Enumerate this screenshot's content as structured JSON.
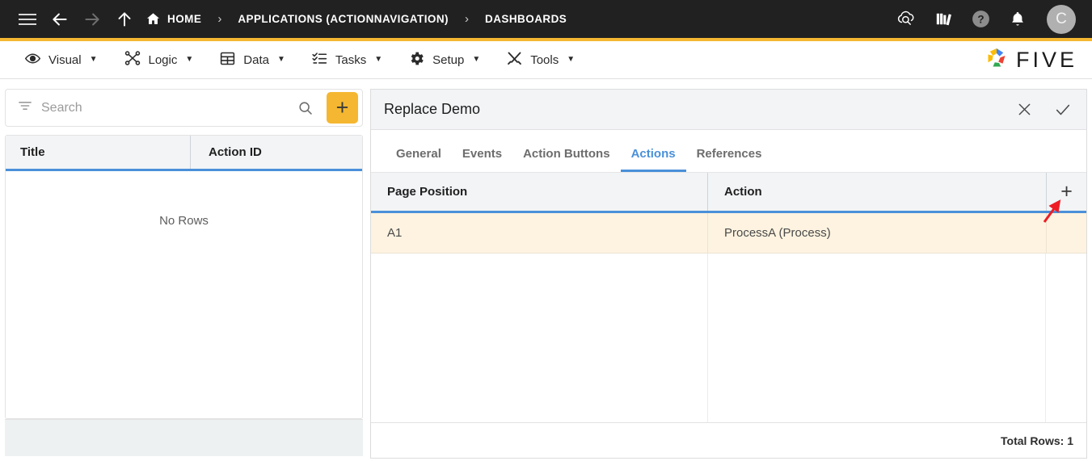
{
  "topbar": {
    "icons": {
      "menu": "hamburger-icon",
      "back": "arrow-left-icon",
      "forward": "arrow-right-icon",
      "up": "arrow-up-icon",
      "home": "home-icon",
      "cloud": "cloud-search-icon",
      "library": "books-icon",
      "help": "question-mark-icon",
      "notifications": "bell-icon"
    },
    "breadcrumb": [
      {
        "label": "HOME",
        "icon": "home-icon"
      },
      {
        "label": "APPLICATIONS (ACTIONNAVIGATION)"
      },
      {
        "label": "DASHBOARDS"
      }
    ],
    "separator": "›",
    "avatar_initial": "C"
  },
  "menubar": {
    "items": [
      {
        "label": "Visual",
        "icon": "eye-icon",
        "caret": "▼"
      },
      {
        "label": "Logic",
        "icon": "logic-nodes-icon",
        "caret": "▼"
      },
      {
        "label": "Data",
        "icon": "table-grid-icon",
        "caret": "▼"
      },
      {
        "label": "Tasks",
        "icon": "checklist-icon",
        "caret": "▼"
      },
      {
        "label": "Setup",
        "icon": "gear-icon",
        "caret": "▼"
      },
      {
        "label": "Tools",
        "icon": "wrench-screwdriver-icon",
        "caret": "▼"
      }
    ],
    "brand": "FIVE"
  },
  "left_panel": {
    "search": {
      "placeholder": "Search",
      "value": ""
    },
    "filter_icon": "filter-icon",
    "search_icon": "search-icon",
    "add_button_label": "+",
    "grid": {
      "columns": [
        "Title",
        "Action ID"
      ],
      "rows": [],
      "empty_message": "No Rows"
    }
  },
  "right_panel": {
    "title": "Replace Demo",
    "close_label": "✕",
    "confirm_label": "✓",
    "tabs": [
      {
        "label": "General",
        "active": false
      },
      {
        "label": "Events",
        "active": false
      },
      {
        "label": "Action Buttons",
        "active": false
      },
      {
        "label": "Actions",
        "active": true
      },
      {
        "label": "References",
        "active": false
      }
    ],
    "grid": {
      "columns": [
        "Page Position",
        "Action"
      ],
      "add_row_label": "+",
      "rows": [
        {
          "page_position": "A1",
          "action": "ProcessA (Process)"
        }
      ],
      "footer": "Total Rows: 1"
    }
  },
  "annotation": {
    "type": "arrow",
    "color": "#ee1c25",
    "points_to": "add-row-button"
  },
  "colors": {
    "accent_yellow": "#f5b731",
    "accent_blue": "#4a90d9",
    "topbar_dark": "#212121",
    "row_highlight": "#fdf3e0",
    "header_gray": "#f2f4f6"
  }
}
